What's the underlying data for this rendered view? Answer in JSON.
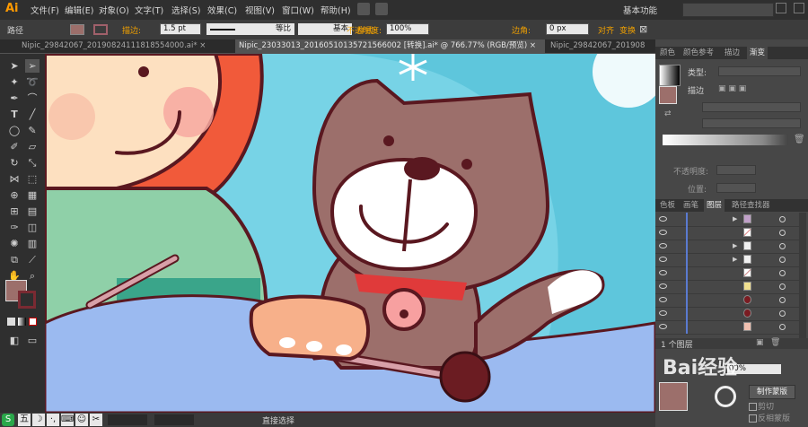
{
  "app": {
    "logo": "Ai",
    "workspace": "基本功能"
  },
  "menu": [
    "文件(F)",
    "编辑(E)",
    "对象(O)",
    "文字(T)",
    "选择(S)",
    "效果(C)",
    "视图(V)",
    "窗口(W)",
    "帮助(H)"
  ],
  "control": {
    "mode_label": "路径",
    "stroke_label": "描边:",
    "stroke_value": "1.5 pt",
    "profile_label": "等比",
    "brush_label": "基本",
    "style_label": "样式:",
    "opacity_label": "不透明度:",
    "opacity_value": "100%",
    "corner_label": "边角:",
    "corner_value": "0 px",
    "align_label": "对齐",
    "transform_label": "变换"
  },
  "tabs": [
    "Nipic_29842067_20190824111818554000.ai*",
    "Nipic_23033013_20160510135721566002 [转换].ai* @ 766.77% (RGB/预览)",
    "Nipic_29842067_201908"
  ],
  "panels": {
    "color_tabs": [
      "颜色",
      "颜色参考",
      "描边",
      "渐变"
    ],
    "gradient": {
      "type_label": "类型:",
      "stroke_label": "描边",
      "opacity_label": "不透明度:",
      "position_label": "位置:"
    },
    "layer_tabs": [
      "色板",
      "画笔",
      "图层",
      "路径查找器"
    ],
    "layers_count": "1 个图层",
    "transparency_value": "00%",
    "make_mask_label": "制作蒙版",
    "clip_label": "剪切",
    "invert_label": "反相蒙版"
  },
  "status": {
    "tool_label": "直接选择",
    "watermark": "Bai经验"
  },
  "colors": {
    "accent": "#ff9a00",
    "cat_body": "#9c6f6b",
    "outline": "#5a1820",
    "sky": "#77d3e6"
  }
}
